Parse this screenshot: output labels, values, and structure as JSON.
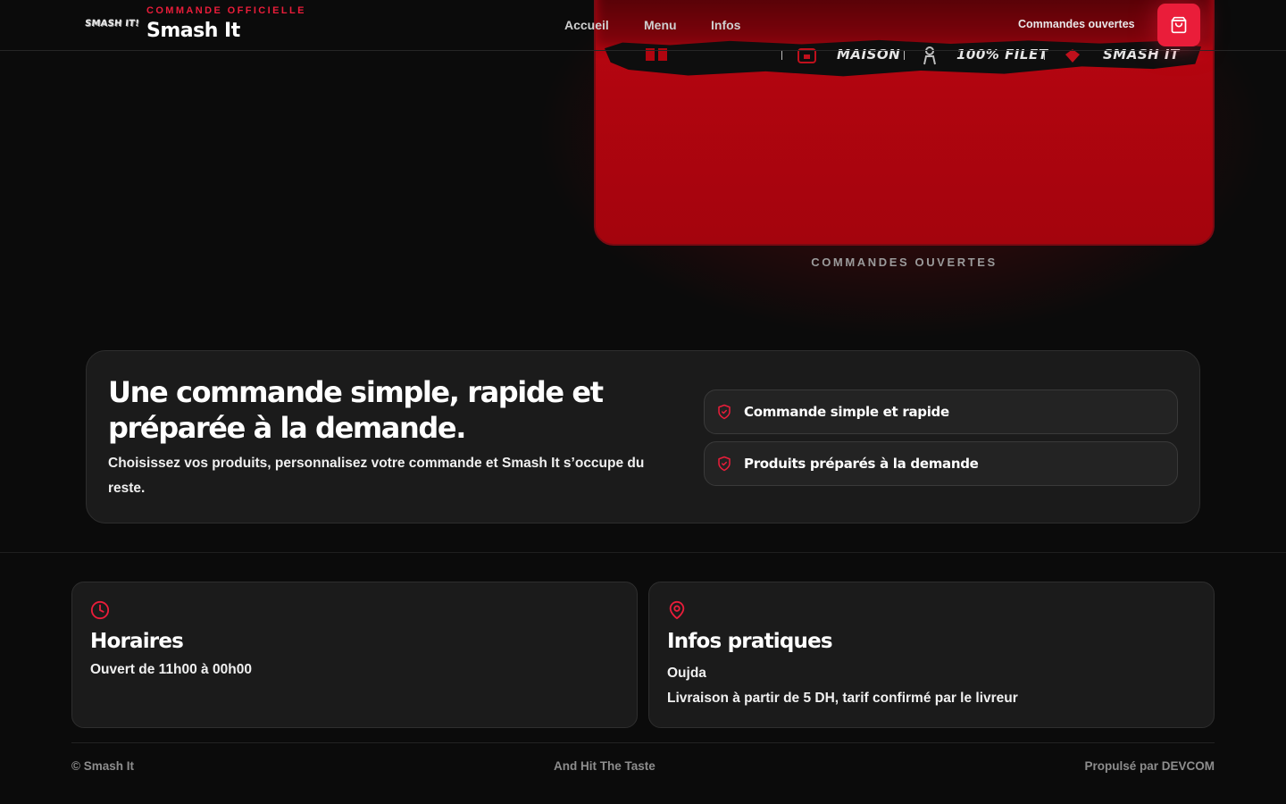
{
  "header": {
    "logo_text": "SMASH IT!",
    "kicker": "COMMANDE OFFICIELLE",
    "brand_name": "Smash It",
    "nav": {
      "accueil": "Accueil",
      "menu": "Menu",
      "infos": "Infos"
    },
    "orders_status": "Commandes ouvertes",
    "cart_icon": "shopping-bag-icon"
  },
  "hero": {
    "strip_items": [
      "MAISON",
      "100% FILET",
      "SMASH IT"
    ],
    "caption": "COMMANDES OUVERTES"
  },
  "feature": {
    "title": "Une commande simple, rapide et préparée à la demande.",
    "description": "Choisissez vos produits, personnalisez votre commande et Smash It s’occupe du reste.",
    "pills": [
      {
        "label": "Commande simple et rapide",
        "icon": "shield-icon"
      },
      {
        "label": "Produits préparés à la demande",
        "icon": "shield-icon"
      }
    ]
  },
  "info": {
    "hours": {
      "icon": "clock-icon",
      "title": "Horaires",
      "line": "Ouvert de 11h00 à 00h00"
    },
    "practical": {
      "icon": "map-pin-icon",
      "title": "Infos pratiques",
      "city": "Oujda",
      "delivery": "Livraison à partir de 5 DH, tarif confirmé par le livreur"
    }
  },
  "footer": {
    "copyright": "© Smash It",
    "tagline": "And Hit The Taste",
    "credit": "Propulsé par DEVCOM"
  },
  "colors": {
    "accent": "#ea1d3a",
    "background": "#0b0b0b",
    "card": "#1b1b1b",
    "hero_red": "#b0050f"
  }
}
